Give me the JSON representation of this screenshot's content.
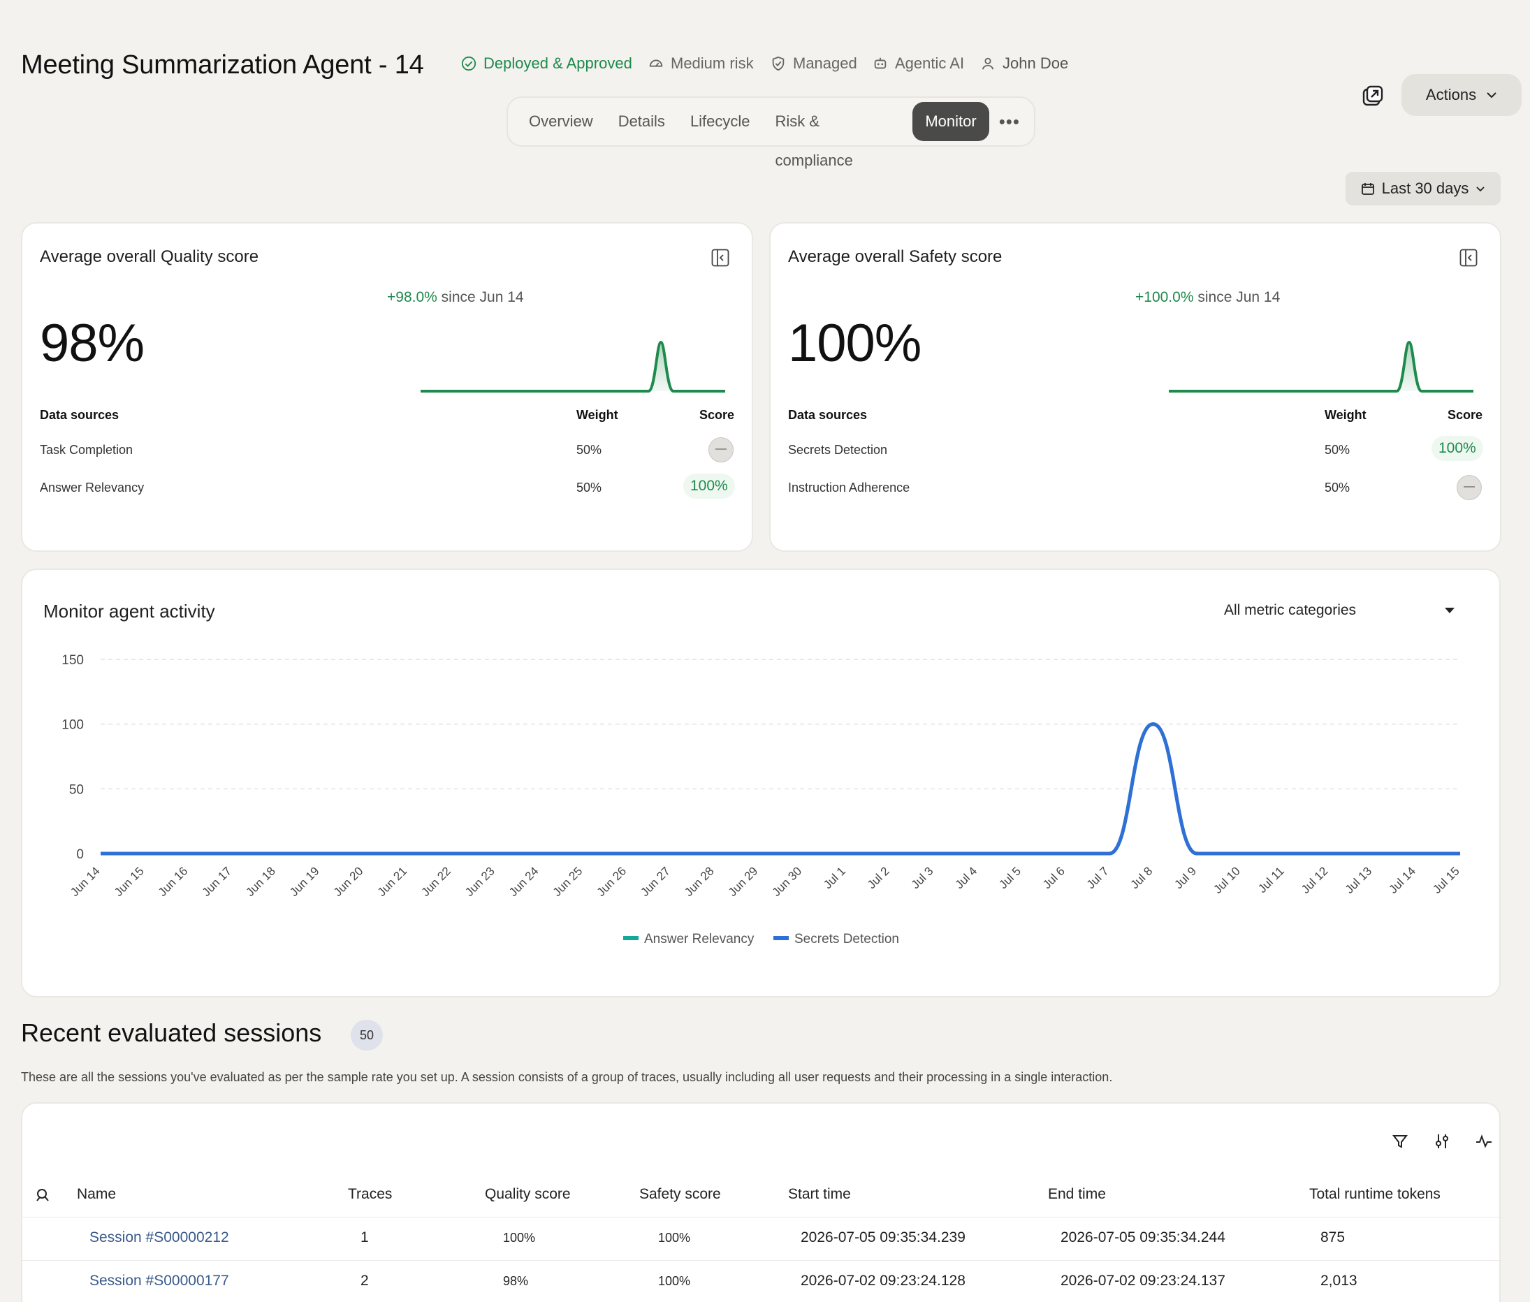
{
  "header": {
    "title": "Meeting Summarization Agent - 14",
    "badges": {
      "status": "Deployed & Approved",
      "risk": "Medium risk",
      "managed": "Managed",
      "type": "Agentic AI",
      "owner": "John Doe"
    },
    "tabs": [
      "Overview",
      "Details",
      "Lifecycle",
      "Risk & compliance",
      "Monitor"
    ],
    "active_tab": "Monitor",
    "more_label": "•••",
    "actions_label": "Actions",
    "date_range": "Last 30 days"
  },
  "quality": {
    "title": "Average overall Quality score",
    "score": "98%",
    "change": "+98.0%",
    "since": "since Jun 14",
    "headers": {
      "source": "Data sources",
      "weight": "Weight",
      "score": "Score"
    },
    "rows": [
      {
        "name": "Task Completion",
        "weight": "50%",
        "score": "—"
      },
      {
        "name": "Answer Relevancy",
        "weight": "50%",
        "score": "100%"
      }
    ]
  },
  "safety": {
    "title": "Average overall Safety score",
    "score": "100%",
    "change": "+100.0%",
    "since": "since Jun 14",
    "headers": {
      "source": "Data sources",
      "weight": "Weight",
      "score": "Score"
    },
    "rows": [
      {
        "name": "Secrets Detection",
        "weight": "50%",
        "score": "100%"
      },
      {
        "name": "Instruction Adherence",
        "weight": "50%",
        "score": "—"
      }
    ]
  },
  "activity": {
    "title": "Monitor agent activity",
    "metric_filter": "All metric categories"
  },
  "chart_data": {
    "type": "line",
    "x": [
      "Jun 14",
      "Jun 15",
      "Jun 16",
      "Jun 17",
      "Jun 18",
      "Jun 19",
      "Jun 20",
      "Jun 21",
      "Jun 22",
      "Jun 23",
      "Jun 24",
      "Jun 25",
      "Jun 26",
      "Jun 27",
      "Jun 28",
      "Jun 29",
      "Jun 30",
      "Jul 1",
      "Jul 2",
      "Jul 3",
      "Jul 4",
      "Jul 5",
      "Jul 6",
      "Jul 7",
      "Jul 8",
      "Jul 9",
      "Jul 10",
      "Jul 11",
      "Jul 12",
      "Jul 13",
      "Jul 14",
      "Jul 15"
    ],
    "yticks": [
      0,
      50,
      100,
      150
    ],
    "ylim": [
      0,
      150
    ],
    "grid": true,
    "legend_position": "bottom",
    "series": [
      {
        "name": "Answer Relevancy",
        "color": "#14a899",
        "values": [
          0,
          0,
          0,
          0,
          0,
          0,
          0,
          0,
          0,
          0,
          0,
          0,
          0,
          0,
          0,
          0,
          0,
          0,
          0,
          0,
          0,
          0,
          0,
          0,
          100,
          0,
          0,
          0,
          0,
          0,
          0,
          0
        ]
      },
      {
        "name": "Secrets Detection",
        "color": "#2f6fd6",
        "values": [
          0,
          0,
          0,
          0,
          0,
          0,
          0,
          0,
          0,
          0,
          0,
          0,
          0,
          0,
          0,
          0,
          0,
          0,
          0,
          0,
          0,
          0,
          0,
          0,
          100,
          0,
          0,
          0,
          0,
          0,
          0,
          0
        ]
      }
    ]
  },
  "sessions": {
    "title": "Recent evaluated sessions",
    "count": "50",
    "description": "These are all the sessions you've evaluated as per the sample rate you set up. A session consists of a group of traces, usually including all user requests and their processing in a single interaction.",
    "columns": [
      "Name",
      "Traces",
      "Quality score",
      "Safety score",
      "Start time",
      "End time",
      "Total runtime tokens"
    ],
    "rows": [
      {
        "name": "Session #S00000212",
        "traces": "1",
        "quality": "100%",
        "safety": "100%",
        "start": "2026-07-05 09:35:34.239",
        "end": "2026-07-05 09:35:34.244",
        "tokens": "875"
      },
      {
        "name": "Session #S00000177",
        "traces": "2",
        "quality": "98%",
        "safety": "100%",
        "start": "2026-07-02 09:23:24.128",
        "end": "2026-07-02 09:23:24.137",
        "tokens": "2,013"
      }
    ]
  },
  "colors": {
    "accent_green": "#1e8a4c",
    "active_tab": "#4a4a48",
    "background": "#f3f2ee"
  }
}
